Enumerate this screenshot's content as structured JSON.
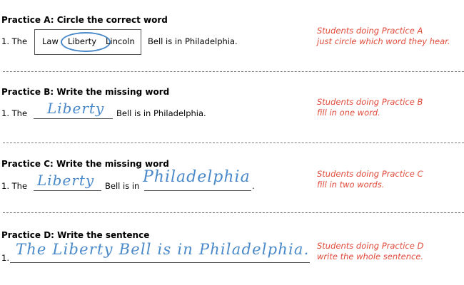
{
  "practice_a": {
    "title": "Practice A: Circle the correct word",
    "number": "1. The",
    "choices": [
      "Law",
      "Liberty",
      "Lincoln"
    ],
    "rest": "Bell is in Philadelphia.",
    "note_line1": "Students doing Practice A",
    "note_line2": "just circle which word they hear."
  },
  "practice_b": {
    "title": "Practice B: Write the missing word",
    "number": "1. The",
    "answer": "Liberty",
    "rest": "Bell is in Philadelphia.",
    "note_line1": "Students doing Practice B",
    "note_line2": "fill in one word."
  },
  "practice_c": {
    "title": "Practice C: Write the missing word",
    "number": "1. The",
    "answer1": "Liberty",
    "middle": "Bell is in",
    "answer2": "Philadelphia",
    "end": ".",
    "note_line1": "Students doing Practice C",
    "note_line2": "fill in two words."
  },
  "practice_d": {
    "title": "Practice D: Write the sentence",
    "number": "1.",
    "sentence": "The Liberty Bell is in Philadelphia.",
    "note_line1": "Students doing Practice D",
    "note_line2": "write the whole sentence."
  },
  "colors": {
    "handwriting": "#4a89c9",
    "note": "#e04a3a"
  }
}
